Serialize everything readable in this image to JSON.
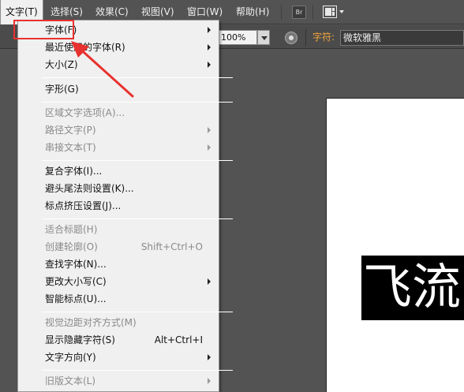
{
  "menubar": {
    "items": [
      {
        "label": "文字(T)",
        "active": true
      },
      {
        "label": "选择(S)",
        "active": false
      },
      {
        "label": "效果(C)",
        "active": false
      },
      {
        "label": "视图(V)",
        "active": false
      },
      {
        "label": "窗口(W)",
        "active": false
      },
      {
        "label": "帮助(H)",
        "active": false
      }
    ],
    "bridge_label": "Br"
  },
  "toolbar": {
    "opacity_value": "100%",
    "character_label": "字符:",
    "font_value": "微软雅黑"
  },
  "canvas": {
    "sample_text": "飞流"
  },
  "menu": {
    "items": [
      {
        "label": "字体(F)",
        "enabled": true,
        "submenu": true,
        "shortcut": ""
      },
      {
        "label": "最近使用的字体(R)",
        "enabled": true,
        "submenu": true,
        "shortcut": ""
      },
      {
        "label": "大小(Z)",
        "enabled": true,
        "submenu": true,
        "shortcut": ""
      },
      {
        "label": "字形(G)",
        "enabled": true,
        "submenu": false,
        "shortcut": ""
      },
      {
        "label": "区域文字选项(A)...",
        "enabled": false,
        "submenu": false,
        "shortcut": ""
      },
      {
        "label": "路径文字(P)",
        "enabled": false,
        "submenu": true,
        "shortcut": ""
      },
      {
        "label": "串接文本(T)",
        "enabled": false,
        "submenu": true,
        "shortcut": ""
      },
      {
        "label": "复合字体(I)...",
        "enabled": true,
        "submenu": false,
        "shortcut": ""
      },
      {
        "label": "避头尾法则设置(K)...",
        "enabled": true,
        "submenu": false,
        "shortcut": ""
      },
      {
        "label": "标点挤压设置(J)...",
        "enabled": true,
        "submenu": false,
        "shortcut": ""
      },
      {
        "label": "适合标题(H)",
        "enabled": false,
        "submenu": false,
        "shortcut": ""
      },
      {
        "label": "创建轮廓(O)",
        "enabled": false,
        "submenu": false,
        "shortcut": "Shift+Ctrl+O"
      },
      {
        "label": "查找字体(N)...",
        "enabled": true,
        "submenu": false,
        "shortcut": ""
      },
      {
        "label": "更改大小写(C)",
        "enabled": true,
        "submenu": true,
        "shortcut": ""
      },
      {
        "label": "智能标点(U)...",
        "enabled": true,
        "submenu": false,
        "shortcut": ""
      },
      {
        "label": "视觉边距对齐方式(M)",
        "enabled": false,
        "submenu": false,
        "shortcut": ""
      },
      {
        "label": "显示隐藏字符(S)",
        "enabled": true,
        "submenu": false,
        "shortcut": "Alt+Ctrl+I"
      },
      {
        "label": "文字方向(Y)",
        "enabled": true,
        "submenu": true,
        "shortcut": ""
      },
      {
        "label": "旧版文本(L)",
        "enabled": false,
        "submenu": true,
        "shortcut": ""
      }
    ]
  },
  "colors": {
    "annotation": "#e8322f",
    "character_label": "#f0a33c",
    "ui_background": "#535353",
    "menu_background": "#f0f0f0"
  }
}
